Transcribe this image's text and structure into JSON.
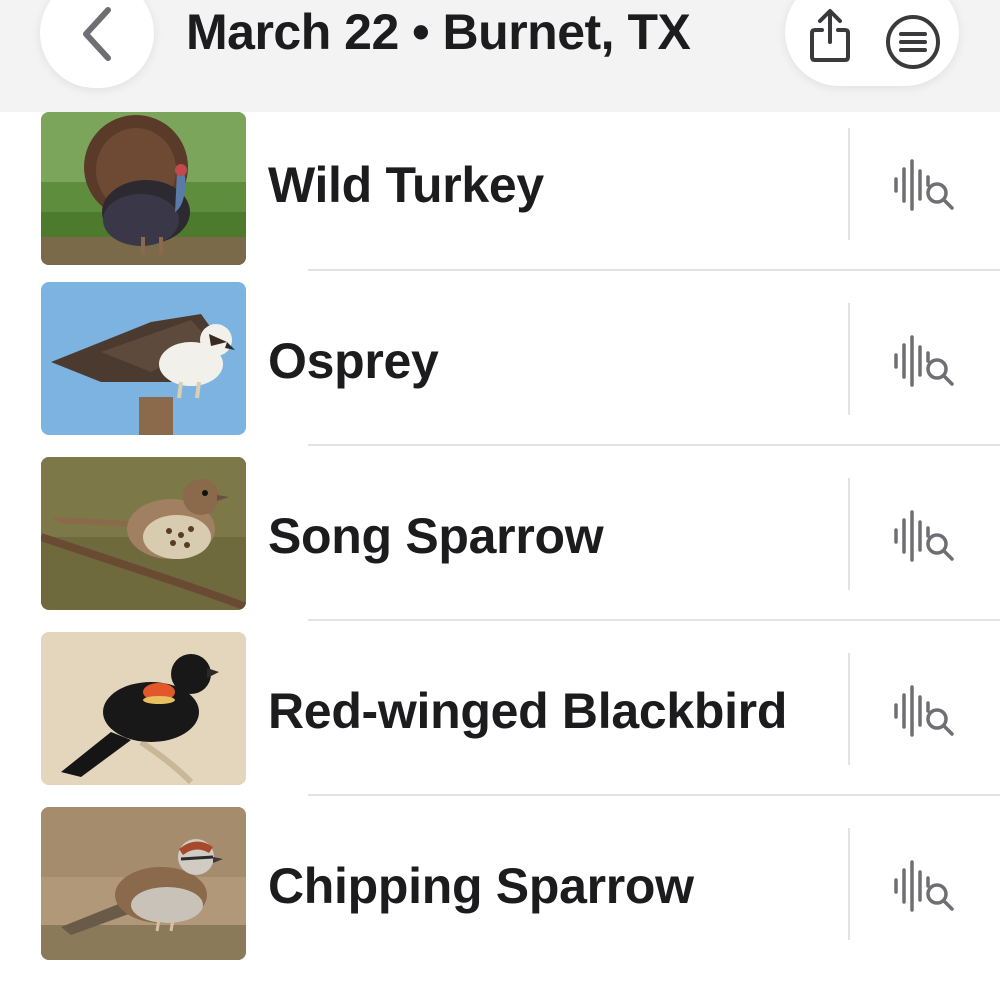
{
  "header": {
    "title": "March 22 • Burnet, TX",
    "back_icon": "chevron-left-icon",
    "share_icon": "share-icon",
    "menu_icon": "list-menu-icon"
  },
  "species": [
    {
      "name": "Wild Turkey",
      "icon": "sound-search-icon"
    },
    {
      "name": "Osprey",
      "icon": "sound-search-icon"
    },
    {
      "name": "Song Sparrow",
      "icon": "sound-search-icon"
    },
    {
      "name": "Red-winged Blackbird",
      "icon": "sound-search-icon"
    },
    {
      "name": "Chipping Sparrow",
      "icon": "sound-search-icon"
    }
  ],
  "colors": {
    "header_bg": "#f3f3f3",
    "text": "#1c1c1e",
    "icon_gray": "#6e6e73",
    "divider": "#e3e3e6"
  }
}
